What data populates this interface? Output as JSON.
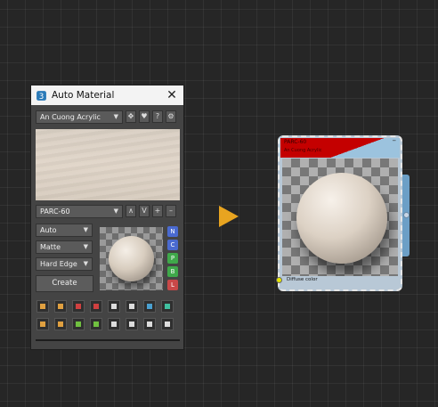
{
  "window": {
    "title": "Auto Material"
  },
  "header": {
    "preset_dropdown": "An Cuong Acrylic"
  },
  "code_row": {
    "code_dropdown": "PARC-60",
    "buttons": [
      "∧",
      "V",
      "+",
      "–"
    ]
  },
  "options": {
    "mapping": "Auto",
    "finish": "Matte",
    "edge": "Hard Edge",
    "create_label": "Create"
  },
  "channel_letters": [
    {
      "label": "N",
      "color": "#4a6ad0"
    },
    {
      "label": "C",
      "color": "#4a6ad0"
    },
    {
      "label": "P",
      "color": "#3fa84a"
    },
    {
      "label": "B",
      "color": "#3fa84a"
    },
    {
      "label": "L",
      "color": "#c84848"
    }
  ],
  "tool_rows": [
    [
      "#e0a040",
      "#e0a040",
      "#d04040",
      "#d04040",
      "#dddddd",
      "#dddddd",
      "#4aa0d0",
      "#40c0a0"
    ],
    [
      "#e0a040",
      "#e0a040",
      "#70c040",
      "#70c040",
      "#dddddd",
      "#dddddd",
      "#dddddd",
      "#dddddd"
    ]
  ],
  "node": {
    "name": "PARC-60",
    "subtitle": "An Cuong Acrylic",
    "port_label": "Diffuse color"
  }
}
